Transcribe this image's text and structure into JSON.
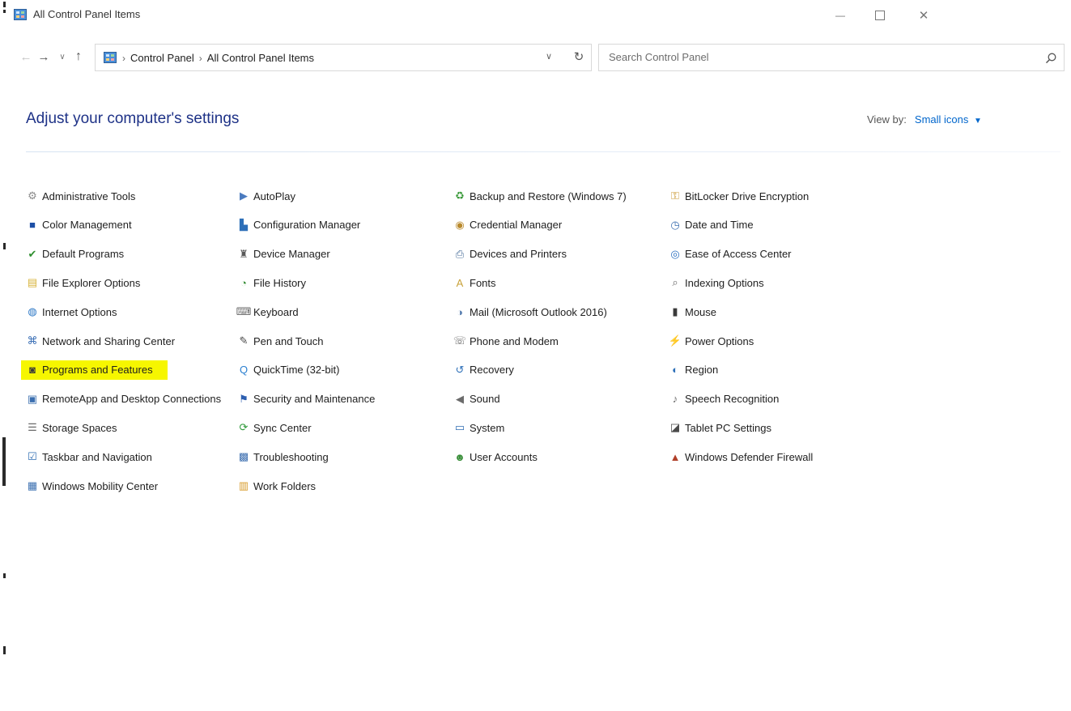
{
  "window": {
    "title": "All Control Panel Items",
    "minimize_glyph": "—",
    "close_glyph": "✕"
  },
  "nav": {
    "back_glyph": "←",
    "forward_glyph": "→",
    "recent_glyph": "∨",
    "up_glyph": "↑"
  },
  "address": {
    "crumbs": [
      "Control Panel",
      "All Control Panel Items"
    ],
    "separator": "›",
    "dropdown_glyph": "∨",
    "refresh_glyph": "↻"
  },
  "search": {
    "placeholder": "Search Control Panel"
  },
  "header": {
    "title": "Adjust your computer's settings",
    "view_by_label": "View by:",
    "view_by_value": "Small icons",
    "view_by_caret": "▼"
  },
  "columns": [
    [
      {
        "label": "Administrative Tools",
        "icon": "admin-tools-icon",
        "color": "#8a8a8a",
        "glyph": "⚙"
      },
      {
        "label": "Color Management",
        "icon": "color-management-icon",
        "color": "#1d4fa6",
        "glyph": "■"
      },
      {
        "label": "Default Programs",
        "icon": "default-programs-icon",
        "color": "#2f8f2f",
        "glyph": "✔"
      },
      {
        "label": "File Explorer Options",
        "icon": "file-explorer-options-icon",
        "color": "#d8b43c",
        "glyph": "▤"
      },
      {
        "label": "Internet Options",
        "icon": "internet-options-icon",
        "color": "#2b77c5",
        "glyph": "◍"
      },
      {
        "label": "Network and Sharing Center",
        "icon": "network-sharing-icon",
        "color": "#3a6fb6",
        "glyph": "⌘"
      },
      {
        "label": "Programs and Features",
        "icon": "programs-features-icon",
        "color": "#3a3a3a",
        "glyph": "◙",
        "highlight": true
      },
      {
        "label": "RemoteApp and Desktop Connections",
        "icon": "remoteapp-icon",
        "color": "#3b6fb0",
        "glyph": "▣"
      },
      {
        "label": "Storage Spaces",
        "icon": "storage-spaces-icon",
        "color": "#6b6b6b",
        "glyph": "☰"
      },
      {
        "label": "Taskbar and Navigation",
        "icon": "taskbar-navigation-icon",
        "color": "#2f6db3",
        "glyph": "☑"
      },
      {
        "label": "Windows Mobility Center",
        "icon": "mobility-center-icon",
        "color": "#3b6fb0",
        "glyph": "▦"
      }
    ],
    [
      {
        "label": "AutoPlay",
        "icon": "autoplay-icon",
        "color": "#4b7bbf",
        "glyph": "▶"
      },
      {
        "label": "Configuration Manager",
        "icon": "configuration-manager-icon",
        "color": "#2d6fb8",
        "glyph": "▙"
      },
      {
        "label": "Device Manager",
        "icon": "device-manager-icon",
        "color": "#5a5a5a",
        "glyph": "♜"
      },
      {
        "label": "File History",
        "icon": "file-history-icon",
        "color": "#3a8f3a",
        "glyph": "◔"
      },
      {
        "label": "Keyboard",
        "icon": "keyboard-icon",
        "color": "#6b6b6b",
        "glyph": "⌨"
      },
      {
        "label": "Pen and Touch",
        "icon": "pen-touch-icon",
        "color": "#4a4a4a",
        "glyph": "✎"
      },
      {
        "label": "QuickTime (32-bit)",
        "icon": "quicktime-icon",
        "color": "#2a7fd0",
        "glyph": "Q"
      },
      {
        "label": "Security and Maintenance",
        "icon": "security-maintenance-icon",
        "color": "#2d5fb0",
        "glyph": "⚑"
      },
      {
        "label": "Sync Center",
        "icon": "sync-center-icon",
        "color": "#2f9a3a",
        "glyph": "⟳"
      },
      {
        "label": "Troubleshooting",
        "icon": "troubleshooting-icon",
        "color": "#3d6fb0",
        "glyph": "▩"
      },
      {
        "label": "Work Folders",
        "icon": "work-folders-icon",
        "color": "#d79a28",
        "glyph": "▥"
      }
    ],
    [
      {
        "label": "Backup and Restore (Windows 7)",
        "icon": "backup-restore-icon",
        "color": "#3a9a3a",
        "glyph": "♻"
      },
      {
        "label": "Credential Manager",
        "icon": "credential-manager-icon",
        "color": "#b98a2e",
        "glyph": "◉"
      },
      {
        "label": "Devices and Printers",
        "icon": "devices-printers-icon",
        "color": "#4a6f9a",
        "glyph": "⎙"
      },
      {
        "label": "Fonts",
        "icon": "fonts-icon",
        "color": "#c8a23a",
        "glyph": "A"
      },
      {
        "label": "Mail (Microsoft Outlook 2016)",
        "icon": "mail-icon",
        "color": "#5a7fb0",
        "glyph": "◑"
      },
      {
        "label": "Phone and Modem",
        "icon": "phone-modem-icon",
        "color": "#6b6b6b",
        "glyph": "☏"
      },
      {
        "label": "Recovery",
        "icon": "recovery-icon",
        "color": "#2d6fb8",
        "glyph": "↺"
      },
      {
        "label": "Sound",
        "icon": "sound-icon",
        "color": "#6b6b6b",
        "glyph": "◀"
      },
      {
        "label": "System",
        "icon": "system-icon",
        "color": "#2f6db3",
        "glyph": "▭"
      },
      {
        "label": "User Accounts",
        "icon": "user-accounts-icon",
        "color": "#3a8f3a",
        "glyph": "☻"
      }
    ],
    [
      {
        "label": "BitLocker Drive Encryption",
        "icon": "bitlocker-icon",
        "color": "#c9962e",
        "glyph": "⚿"
      },
      {
        "label": "Date and Time",
        "icon": "date-time-icon",
        "color": "#3d6fb0",
        "glyph": "◷"
      },
      {
        "label": "Ease of Access Center",
        "icon": "ease-of-access-icon",
        "color": "#2a6fc0",
        "glyph": "◎"
      },
      {
        "label": "Indexing Options",
        "icon": "indexing-options-icon",
        "color": "#6b6b6b",
        "glyph": "⌕"
      },
      {
        "label": "Mouse",
        "icon": "mouse-icon",
        "color": "#3a3a3a",
        "glyph": "▮"
      },
      {
        "label": "Power Options",
        "icon": "power-options-icon",
        "color": "#3a8f3a",
        "glyph": "⚡"
      },
      {
        "label": "Region",
        "icon": "region-icon",
        "color": "#2d6fb8",
        "glyph": "◐"
      },
      {
        "label": "Speech Recognition",
        "icon": "speech-recognition-icon",
        "color": "#6b6b6b",
        "glyph": "♪"
      },
      {
        "label": "Tablet PC Settings",
        "icon": "tablet-pc-icon",
        "color": "#4a4a4a",
        "glyph": "◪"
      },
      {
        "label": "Windows Defender Firewall",
        "icon": "firewall-icon",
        "color": "#b0402a",
        "glyph": "▲"
      }
    ]
  ]
}
